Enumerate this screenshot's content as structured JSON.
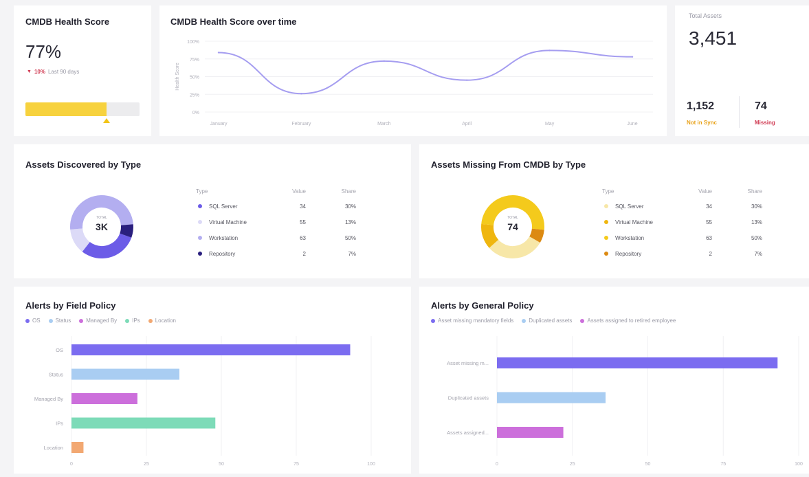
{
  "health_score": {
    "title": "CMDB Health Score",
    "value": "77%",
    "change_arrow": "▼",
    "change_pct": "10%",
    "change_period": "Last 90 days",
    "progress": 0.71,
    "progress_color": "#f7d23e",
    "marker_icon": "triangle-up-icon"
  },
  "health_over_time": {
    "title": "CMDB Health Score over time",
    "chart_data": {
      "type": "line",
      "title": "CMDB Health Score over time",
      "ylabel": "Health Score",
      "xlabel": "",
      "categories": [
        "January",
        "February",
        "March",
        "April",
        "May",
        "June"
      ],
      "y_ticks": [
        "100%",
        "75%",
        "50%",
        "25%",
        "0%"
      ],
      "ylim": [
        0,
        100
      ],
      "series": [
        {
          "values": [
            84,
            26,
            72,
            45,
            87,
            78
          ]
        }
      ],
      "color": "#a59df0"
    }
  },
  "total_assets": {
    "label": "Total Assets",
    "value": "3,451",
    "not_in_sync_value": "1,152",
    "not_in_sync_label": "Not in Sync",
    "missing_value": "74",
    "missing_label": "Missing",
    "not_in_sync_color": "#e8a21a",
    "missing_color": "#d03a52"
  },
  "discovered": {
    "title": "Assets Discovered by Type",
    "center_label": "TOTAL",
    "center_value": "3K",
    "headers": {
      "type": "Type",
      "value": "Value",
      "share": "Share"
    },
    "rows": [
      {
        "type": "SQL Server",
        "value": "34",
        "share": "30%",
        "color": "#6c5ce7"
      },
      {
        "type": "Virtual Machine",
        "value": "55",
        "share": "13%",
        "color": "#dcdaf7"
      },
      {
        "type": "Workstation",
        "value": "63",
        "share": "50%",
        "color": "#b3aef0"
      },
      {
        "type": "Repository",
        "value": "2",
        "share": "7%",
        "color": "#2a1f7e"
      }
    ],
    "chart_data": {
      "type": "pie",
      "categories": [
        "SQL Server",
        "Virtual Machine",
        "Workstation",
        "Repository"
      ],
      "values": [
        30,
        13,
        50,
        7
      ]
    }
  },
  "missing": {
    "title": "Assets Missing From CMDB by Type",
    "center_label": "TOTAL",
    "center_value": "74",
    "headers": {
      "type": "Type",
      "value": "Value",
      "share": "Share"
    },
    "rows": [
      {
        "type": "SQL Server",
        "value": "34",
        "share": "30%",
        "color": "#f7e7a8"
      },
      {
        "type": "Virtual Machine",
        "value": "55",
        "share": "13%",
        "color": "#efb60f"
      },
      {
        "type": "Workstation",
        "value": "63",
        "share": "50%",
        "color": "#f4ca1c"
      },
      {
        "type": "Repository",
        "value": "2",
        "share": "7%",
        "color": "#dc8a12"
      }
    ],
    "chart_data": {
      "type": "pie",
      "categories": [
        "SQL Server",
        "Virtual Machine",
        "Workstation",
        "Repository"
      ],
      "values": [
        30,
        13,
        50,
        7
      ]
    }
  },
  "field_policy": {
    "title": "Alerts by Field Policy",
    "chart_data": {
      "type": "bar",
      "orientation": "horizontal",
      "categories": [
        "OS",
        "Status",
        "Managed By",
        "IPs",
        "Location"
      ],
      "values": [
        93,
        36,
        22,
        48,
        4
      ],
      "colors": [
        "#7b6cf0",
        "#a9cdf2",
        "#cc6fdb",
        "#7ddbb8",
        "#f2a872"
      ],
      "x_ticks": [
        "0",
        "25",
        "50",
        "75",
        "100"
      ],
      "xlim": [
        0,
        100
      ],
      "legend": [
        "OS",
        "Status",
        "Managed By",
        "IPs",
        "Location"
      ]
    }
  },
  "general_policy": {
    "title": "Alerts by General Policy",
    "chart_data": {
      "type": "bar",
      "orientation": "horizontal",
      "categories": [
        "Asset missing m...",
        "Duplicated assets",
        "Assets assigned..."
      ],
      "values": [
        93,
        36,
        22
      ],
      "colors": [
        "#7b6cf0",
        "#a9cdf2",
        "#cc6fdb"
      ],
      "x_ticks": [
        "0",
        "25",
        "50",
        "75",
        "100"
      ],
      "xlim": [
        0,
        100
      ],
      "legend": [
        "Asset missing mandatory fields",
        "Duplicated assets",
        "Assets assigned to retired employee"
      ]
    }
  }
}
